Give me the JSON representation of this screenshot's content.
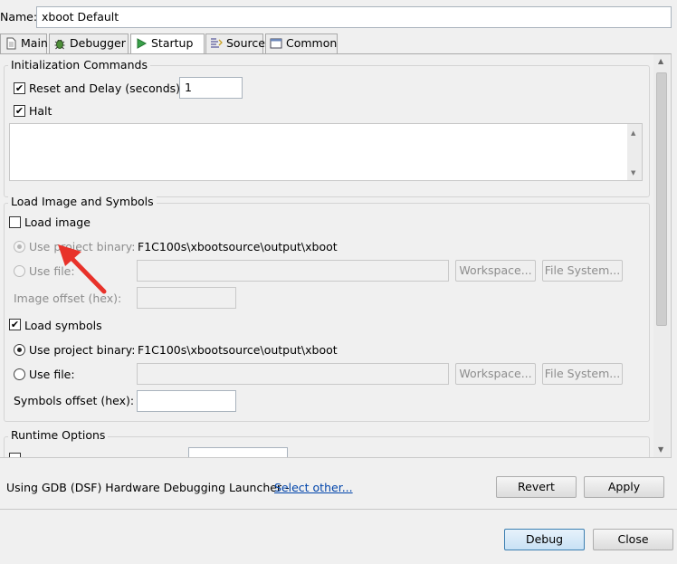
{
  "header": {
    "name_label": "Name:",
    "name_value": "xboot Default"
  },
  "tabs": [
    {
      "label": "Main",
      "icon": "document-icon"
    },
    {
      "label": "Debugger",
      "icon": "bug-icon"
    },
    {
      "label": "Startup",
      "icon": "play-icon",
      "active": true
    },
    {
      "label": "Source",
      "icon": "source-icon"
    },
    {
      "label": "Common",
      "icon": "window-icon"
    }
  ],
  "init": {
    "title": "Initialization Commands",
    "reset_label": "Reset and Delay (seconds):",
    "reset_checked": true,
    "delay_value": "1",
    "halt_label": "Halt",
    "halt_checked": true,
    "commands_text": ""
  },
  "load": {
    "title": "Load Image and Symbols",
    "load_image_label": "Load image",
    "load_image_checked": false,
    "image_project_label": "Use project binary:",
    "image_project_value": "F1C100s\\xbootsource\\output\\xboot",
    "image_file_label": "Use file:",
    "image_file_value": "",
    "image_offset_label": "Image offset (hex):",
    "image_offset_value": "",
    "load_symbols_label": "Load symbols",
    "load_symbols_checked": true,
    "symbols_project_label": "Use project binary:",
    "symbols_project_value": "F1C100s\\xbootsource\\output\\xboot",
    "symbols_file_label": "Use file:",
    "symbols_file_value": "",
    "symbols_offset_label": "Symbols offset (hex):",
    "symbols_offset_value": "",
    "workspace_label": "Workspace...",
    "filesystem_label": "File System..."
  },
  "runtime": {
    "title": "Runtime Options"
  },
  "footer": {
    "launcher_text": "Using GDB (DSF) Hardware Debugging Launcher -",
    "select_other": "Select other...",
    "revert_label": "Revert",
    "apply_label": "Apply",
    "debug_label": "Debug",
    "close_label": "Close"
  },
  "colors": {
    "arrow": "#e8322a",
    "link": "#0044aa",
    "default_button": "#3c7fb1"
  }
}
